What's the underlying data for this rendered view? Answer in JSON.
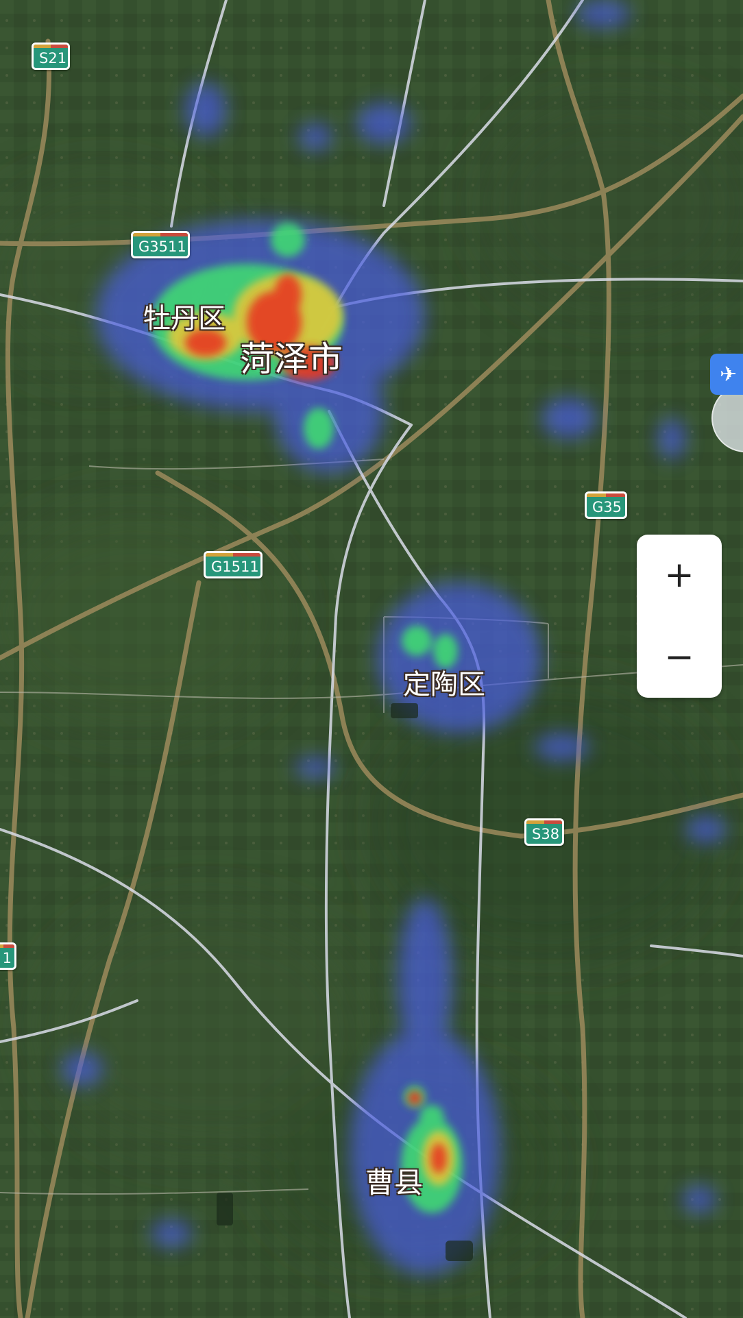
{
  "places": {
    "heze": "菏泽市",
    "mudan": "牡丹区",
    "dingtao": "定陶区",
    "caoxian": "曹县"
  },
  "road_shields": {
    "s21": "S21",
    "g3511": "G3511",
    "g1511": "G1511",
    "g35": "G35",
    "s38": "S38",
    "partial_left": "1"
  },
  "controls": {
    "zoom_in": "+",
    "zoom_out": "−",
    "airport_icon": "airplane-icon"
  },
  "heatmap_legend_colors": {
    "low": "#4a5de0",
    "mid": "#40e070",
    "high": "#e63a22"
  }
}
